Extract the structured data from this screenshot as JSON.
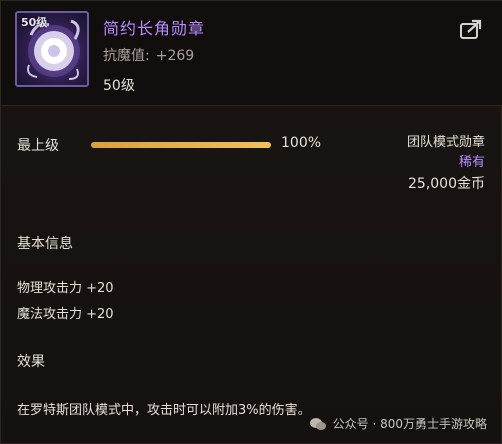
{
  "item": {
    "level_badge": "50级",
    "name": "简约长角勋章",
    "magic_resist_label": "抗魔值:",
    "magic_resist_value": "+269",
    "required_level": "50级",
    "icon": "medal-icon",
    "name_color": "#b48cff"
  },
  "upgrade": {
    "label": "最上级",
    "progress": 1.0,
    "percent_text": "100%"
  },
  "info": {
    "mode": "团队模式勋章",
    "rarity": "稀有",
    "price": "25,000金币"
  },
  "basic_info": {
    "title": "基本信息",
    "stats": [
      "物理攻击力 +20",
      "魔法攻击力 +20"
    ]
  },
  "effect": {
    "title": "效果",
    "text": "在罗特斯团队模式中，攻击时可以附加3%的伤害。"
  },
  "watermark": {
    "text": "公众号 · 800万勇士手游攻略",
    "icon": "wechat-icon"
  },
  "colors": {
    "accent_purple": "#b48cff",
    "progress_gold": "#e8b24a"
  }
}
